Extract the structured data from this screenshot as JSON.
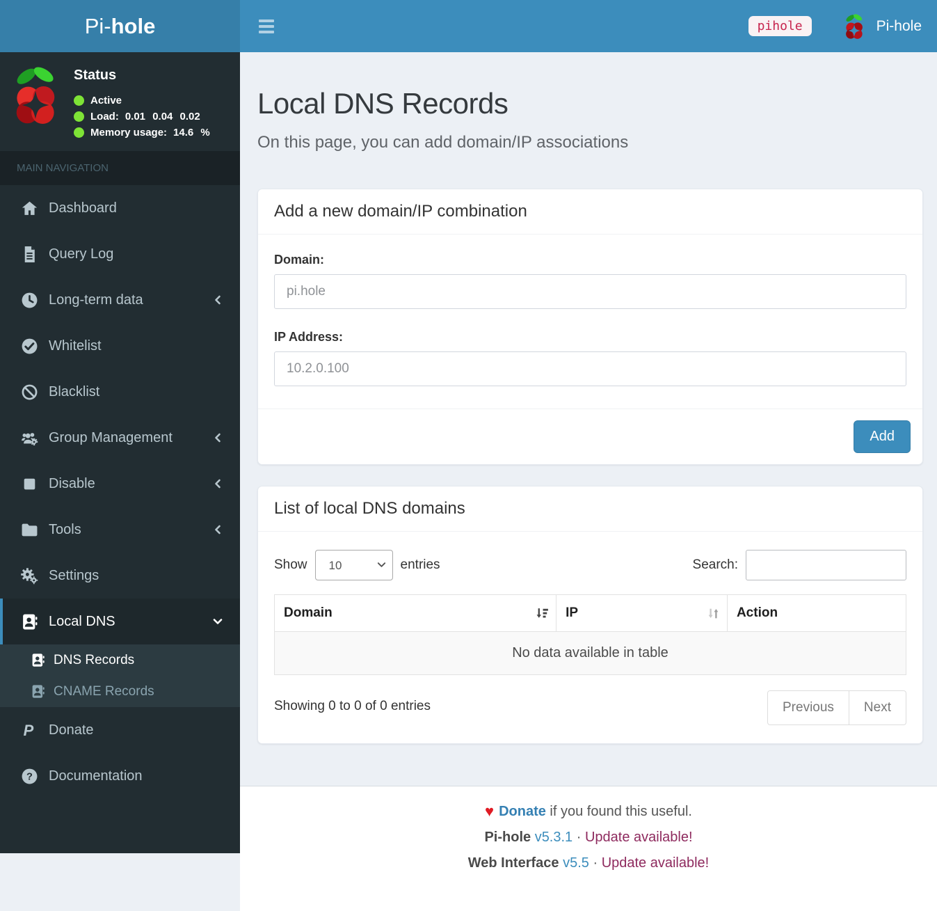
{
  "colors": {
    "navbar": "#3c8dbc",
    "logo_bg": "#367fa9",
    "sidebar_bg": "#222d32",
    "sidebar_dark_strip": "#1a2226",
    "submenu_bg": "#2c3b41",
    "active_item_bg": "#1e282c",
    "accent": "#3c8dbc",
    "status_green": "#7ee336",
    "page_bg": "#ecf0f5",
    "badge_bg": "#f9f2f4",
    "badge_text": "#c7254e",
    "update_text": "#8e2a5e",
    "heart_red": "#e01b24"
  },
  "logo": {
    "brand_prefix": "Pi-",
    "brand_suffix": "hole"
  },
  "topbar": {
    "hostname_badge": "pihole",
    "brand": "Pi-hole",
    "icons": {
      "menu": "bars-icon",
      "brand": "raspberry-icon"
    }
  },
  "status": {
    "title": "Status",
    "active_label": "Active",
    "load_label": "Load:",
    "load_values": "0.01 0.04 0.02",
    "memory_label": "Memory usage:",
    "memory_value": "14.6 %"
  },
  "sidebar": {
    "section_header": "MAIN NAVIGATION",
    "items": [
      {
        "label": "Dashboard",
        "icon": "home-icon"
      },
      {
        "label": "Query Log",
        "icon": "file-icon"
      },
      {
        "label": "Long-term data",
        "icon": "clock-icon",
        "chevron": "chevron-left-icon"
      },
      {
        "label": "Whitelist",
        "icon": "check-circle-icon"
      },
      {
        "label": "Blacklist",
        "icon": "ban-icon"
      },
      {
        "label": "Group Management",
        "icon": "users-gear-icon",
        "chevron": "chevron-left-icon"
      },
      {
        "label": "Disable",
        "icon": "stop-icon",
        "chevron": "chevron-left-icon"
      },
      {
        "label": "Tools",
        "icon": "folder-icon",
        "chevron": "chevron-left-icon"
      },
      {
        "label": "Settings",
        "icon": "gears-icon"
      },
      {
        "label": "Local DNS",
        "icon": "address-book-icon",
        "chevron": "chevron-down-icon",
        "active": true
      }
    ],
    "submenu_items": [
      {
        "label": "DNS Records",
        "icon": "address-book-icon",
        "active": true
      },
      {
        "label": "CNAME Records",
        "icon": "address-book-icon"
      }
    ],
    "items_after": [
      {
        "label": "Donate",
        "icon": "paypal-icon"
      },
      {
        "label": "Documentation",
        "icon": "question-circle-icon"
      }
    ]
  },
  "page": {
    "title": "Local DNS Records",
    "subtitle": "On this page, you can add domain/IP associations"
  },
  "add_card": {
    "title": "Add a new domain/IP combination",
    "domain_label": "Domain:",
    "domain_placeholder": "pi.hole",
    "domain_value": "",
    "ip_label": "IP Address:",
    "ip_placeholder": "10.2.0.100",
    "ip_value": "",
    "add_button": "Add"
  },
  "list_card": {
    "title": "List of local DNS domains",
    "show_label": "Show",
    "page_length": "10",
    "entries_label": "entries",
    "search_label": "Search:",
    "search_value": "",
    "columns": [
      "Domain",
      "IP",
      "Action"
    ],
    "sort_icons": {
      "domain": "sort-amount-down-icon",
      "ip": "sort-both-icon"
    },
    "empty_text": "No data available in table",
    "rows": [],
    "info_text": "Showing 0 to 0 of 0 entries",
    "prev_label": "Previous",
    "next_label": "Next"
  },
  "footer": {
    "heart_icon": "heart-icon",
    "donate_label": "Donate",
    "donate_suffix": " if you found this useful.",
    "product": "Pi-hole",
    "version": "v5.3.1",
    "dot": "·",
    "update_text": "Update available!",
    "line3_product": "Web Interface",
    "line3_version": "v5.5",
    "line3_dot": "·",
    "line3_update": "Update available!"
  }
}
